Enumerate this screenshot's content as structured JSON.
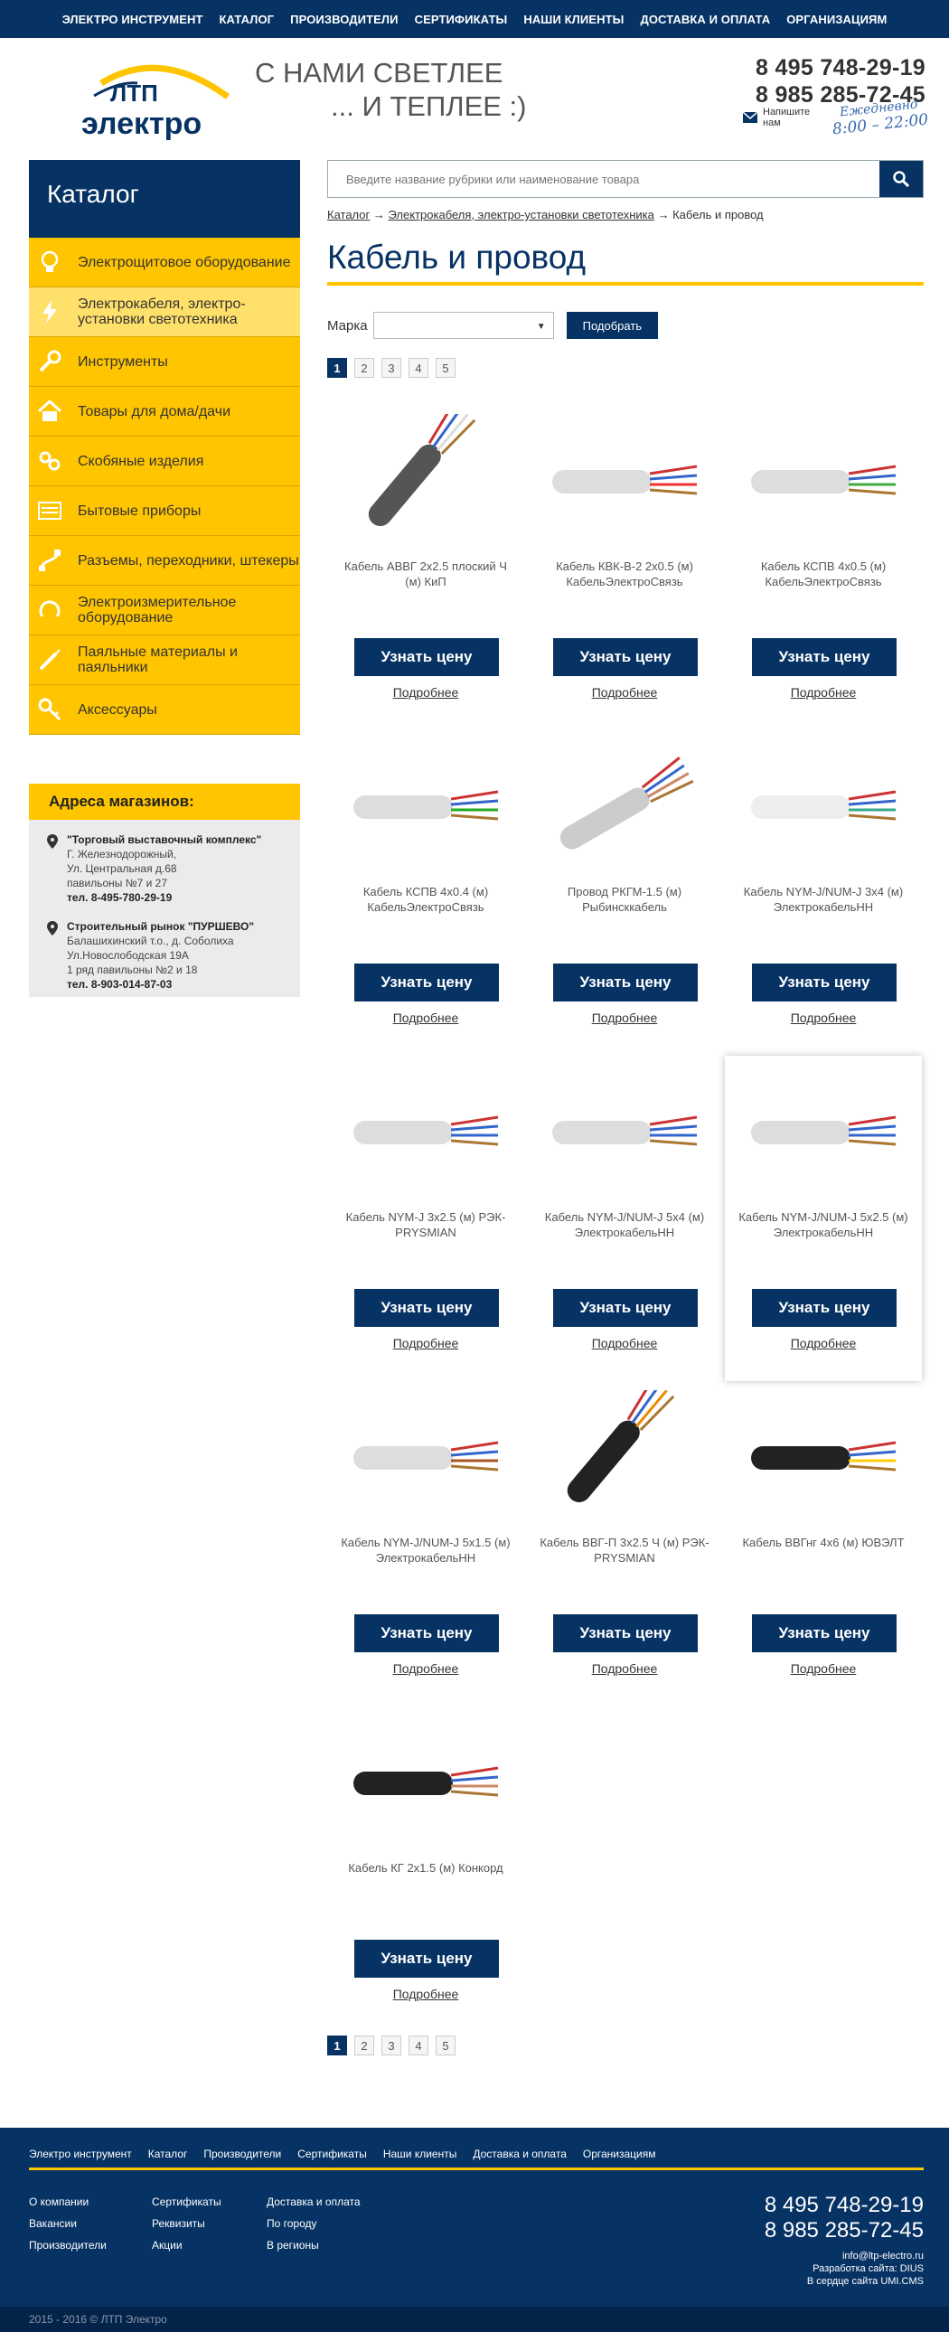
{
  "topnav": [
    "ЭЛЕКТРО ИНСТРУМЕНТ",
    "КАТАЛОГ",
    "ПРОИЗВОДИТЕЛИ",
    "СЕРТИФИКАТЫ",
    "НАШИ КЛИЕНТЫ",
    "ДОСТАВКА И ОПЛАТА",
    "ОРГАНИЗАЦИЯМ"
  ],
  "logo": {
    "line1": "ЛТП",
    "line2": "электро"
  },
  "slogan": {
    "line1": "С НАМИ СВЕТЛЕЕ",
    "line2": "... И ТЕПЛЕЕ :)"
  },
  "phones": [
    "8 495 748-29-19",
    "8 985 285-72-45"
  ],
  "writeus": {
    "line1": "Напишите",
    "line2": "нам"
  },
  "daily": {
    "line1": "Ежедневно",
    "line2": "8:00 – 22:00"
  },
  "sidebar": {
    "title": "Каталог",
    "items": [
      {
        "label": "Электрощитовое оборудование",
        "icon": "bulb-icon"
      },
      {
        "label": "Электрокабеля, электро-установки светотехника",
        "icon": "lightning-icon",
        "active": true
      },
      {
        "label": "Инструменты",
        "icon": "wrench-icon"
      },
      {
        "label": "Товары для дома/дачи",
        "icon": "house-icon"
      },
      {
        "label": "Скобяные изделия",
        "icon": "chain-icon"
      },
      {
        "label": "Бытовые приборы",
        "icon": "appliance-icon"
      },
      {
        "label": "Разъемы, переходники, штекеры",
        "icon": "plug-icon"
      },
      {
        "label": "Электроизмерительное оборудование",
        "icon": "meter-icon"
      },
      {
        "label": "Паяльные материалы и паяльники",
        "icon": "soldering-icon"
      },
      {
        "label": "Аксессуары",
        "icon": "key-icon"
      }
    ]
  },
  "addresses": {
    "title": "Адреса магазинов:",
    "stores": [
      {
        "name": "\"Торговый выставочный комплекс\"",
        "lines": [
          "Г. Железнодорожный,",
          "Ул. Центральная д.68",
          "павильоны №7 и 27"
        ],
        "tel": "тел. 8-495-780-29-19"
      },
      {
        "name": "Строительный рынок \"ПУРШЕВО\"",
        "lines": [
          "Балашихинский т.о., д. Соболиха",
          "Ул.Новослободская 19А",
          "1 ряд павильоны №2 и 18"
        ],
        "tel": "тел. 8-903-014-87-03"
      }
    ]
  },
  "search": {
    "placeholder": "Введите название рубрики или наименование товара"
  },
  "breadcrumb": {
    "c1": "Каталог",
    "sep": "→",
    "c2": "Электрокабеля, электро-установки светотехника",
    "c3": "Кабель и провод"
  },
  "page_title": "Кабель и провод",
  "filter": {
    "label": "Марка",
    "value": "",
    "button": "Подобрать"
  },
  "pages": [
    "1",
    "2",
    "3",
    "4",
    "5"
  ],
  "products": [
    {
      "name": "Кабель АВВГ 2х2.5 плоский Ч (м) КиП",
      "image": "cable-avvg"
    },
    {
      "name": "Кабель КВК-В-2 2х0.5 (м) КабельЭлектроСвязь",
      "image": "cable-kvk"
    },
    {
      "name": "Кабель КСПВ 4х0.5 (м) КабельЭлектроСвязь",
      "image": "cable-kspv"
    },
    {
      "name": "Кабель КСПВ 4х0.4 (м) КабельЭлектроСвязь",
      "image": "cable-kspv4"
    },
    {
      "name": "Провод РКГМ-1.5 (м) Рыбинсккабель",
      "image": "wire-rkgm"
    },
    {
      "name": "Кабель NYM-J/NUM-J 3х4 (м) ЭлектрокабельНН",
      "image": "cable-nym3"
    },
    {
      "name": "Кабель NYM-J 3х2.5 (м) РЭК-PRYSMIAN",
      "image": "cable-nym325"
    },
    {
      "name": "Кабель NYM-J/NUM-J 5х4 (м) ЭлектрокабельНН",
      "image": "cable-nym54"
    },
    {
      "name": "Кабель NYM-J/NUM-J 5х2.5 (м) ЭлектрокабельНН",
      "image": "cable-nym525",
      "highlight": true
    },
    {
      "name": "Кабель NYM-J/NUM-J 5х1.5 (м) ЭлектрокабельНН",
      "image": "cable-nym515"
    },
    {
      "name": "Кабель ВВГ-П 3х2.5 Ч (м) РЭК-PRYSMIAN",
      "image": "cable-vvgp"
    },
    {
      "name": "Кабель ВВГнг 4х6 (м) ЮВЭЛТ",
      "image": "cable-vvgng"
    },
    {
      "name": "Кабель КГ 2х1.5 (м) Конкорд",
      "image": "cable-kg"
    }
  ],
  "product_button": "Узнать цену",
  "product_more": "Подробнее",
  "footer": {
    "nav": [
      "Электро инструмент",
      "Каталог",
      "Производители",
      "Сертификаты",
      "Наши клиенты",
      "Доставка и оплата",
      "Организациям"
    ],
    "col1": [
      "О компании",
      "Вакансии",
      "Производители"
    ],
    "col2": [
      "Сертификаты",
      "Реквизиты",
      "Акции"
    ],
    "col3": [
      "Доставка и оплата",
      "По городу",
      "В регионы"
    ],
    "phones": [
      "8 495 748-29-19",
      "8 985 285-72-45"
    ],
    "email": "info@ltp-electro.ru",
    "dev": "Разработка сайта: DIUS",
    "cms": "В сердце сайта UMI.CMS",
    "copyright": "2015 - 2016 © ЛТП Электро"
  },
  "colors": {
    "navy": "#063264",
    "yellow": "#ffc500"
  }
}
